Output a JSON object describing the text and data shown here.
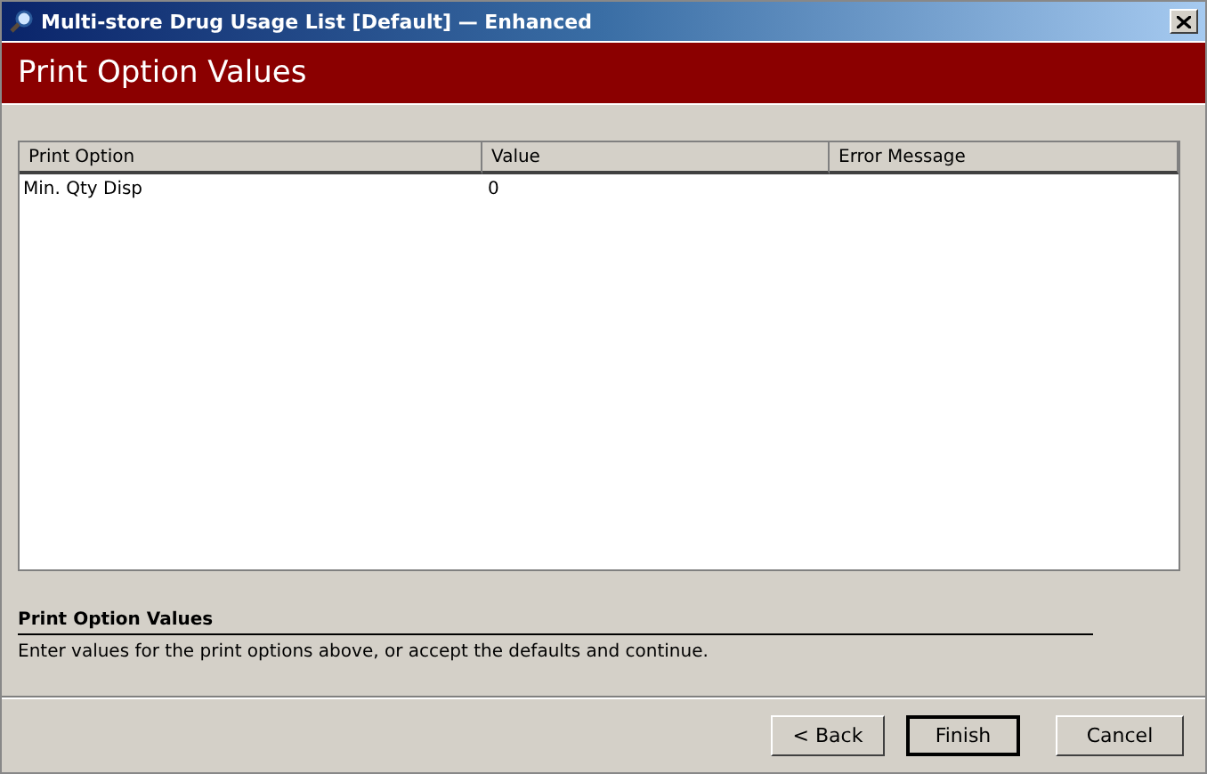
{
  "window": {
    "title": "Multi-store Drug Usage List [Default] — Enhanced"
  },
  "header": {
    "title": "Print Option Values"
  },
  "table": {
    "columns": [
      "Print Option",
      "Value",
      "Error Message"
    ],
    "rows": [
      [
        "Min. Qty Disp",
        "0",
        ""
      ]
    ]
  },
  "info": {
    "title": "Print Option Values",
    "text": "Enter values for the print options above, or accept the defaults and continue."
  },
  "buttons": [
    {
      "label": "< Back",
      "default": false
    },
    {
      "label": "Finish",
      "default": true
    },
    {
      "label": "Cancel",
      "default": false
    }
  ]
}
